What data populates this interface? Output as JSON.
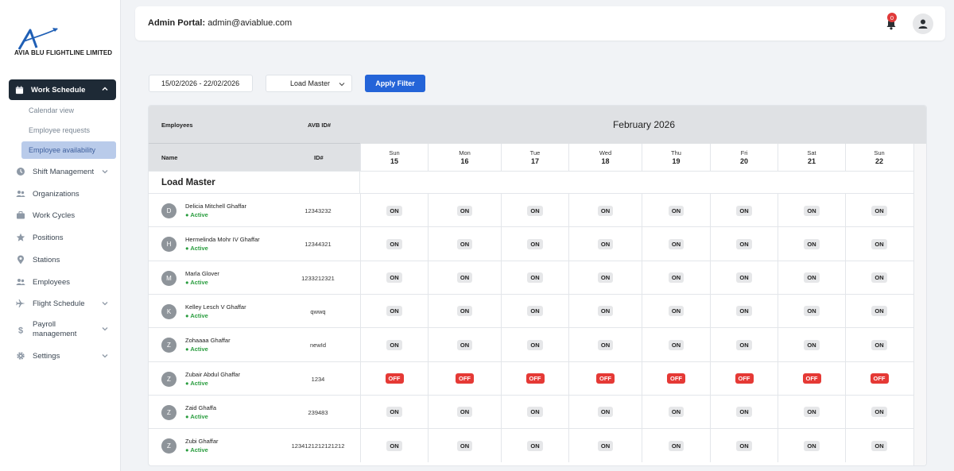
{
  "brand": {
    "name": "AVIA BLU FLIGHTLINE LIMITED"
  },
  "sidebar": {
    "active": {
      "label": "Work Schedule",
      "icon": "calendar-icon"
    },
    "subitems": [
      {
        "label": "Calendar view",
        "selected": false
      },
      {
        "label": "Employee requests",
        "selected": false
      },
      {
        "label": "Employee availability",
        "selected": true
      }
    ],
    "items": [
      {
        "label": "Shift Management",
        "icon": "clock-icon",
        "has_chevron": true
      },
      {
        "label": "Organizations",
        "icon": "users-icon",
        "has_chevron": false
      },
      {
        "label": "Work Cycles",
        "icon": "briefcase-icon",
        "has_chevron": false
      },
      {
        "label": "Positions",
        "icon": "star-icon",
        "has_chevron": false
      },
      {
        "label": "Stations",
        "icon": "map-pin-icon",
        "has_chevron": false
      },
      {
        "label": "Employees",
        "icon": "users-icon",
        "has_chevron": false
      },
      {
        "label": "Flight Schedule",
        "icon": "plane-icon",
        "has_chevron": true
      },
      {
        "label": "Payroll management",
        "icon": "dollar-icon",
        "has_chevron": true
      },
      {
        "label": "Settings",
        "icon": "gear-icon",
        "has_chevron": true
      }
    ]
  },
  "header": {
    "portal_label": "Admin Portal:",
    "email": "admin@aviablue.com",
    "notification_count": "0"
  },
  "filters": {
    "date_range": "15/02/2026 - 22/02/2026",
    "position": "Load Master",
    "apply_label": "Apply Filter"
  },
  "table": {
    "headers": {
      "employees": "Employees",
      "avb_id": "AVB ID#",
      "name": "Name",
      "id": "ID#"
    },
    "month": "February 2026",
    "days": [
      {
        "name": "Sun",
        "date": "15"
      },
      {
        "name": "Mon",
        "date": "16"
      },
      {
        "name": "Tue",
        "date": "17"
      },
      {
        "name": "Wed",
        "date": "18"
      },
      {
        "name": "Thu",
        "date": "19"
      },
      {
        "name": "Fri",
        "date": "20"
      },
      {
        "name": "Sat",
        "date": "21"
      },
      {
        "name": "Sun",
        "date": "22"
      }
    ],
    "group": "Load Master",
    "rows": [
      {
        "initial": "D",
        "name": "Delicia Mitchell Ghaffar",
        "status": "● Active",
        "id": "12343232",
        "days": [
          "ON",
          "ON",
          "ON",
          "ON",
          "ON",
          "ON",
          "ON",
          "ON"
        ]
      },
      {
        "initial": "H",
        "name": "Hermelinda Mohr IV Ghaffar",
        "status": "● Active",
        "id": "12344321",
        "days": [
          "ON",
          "ON",
          "ON",
          "ON",
          "ON",
          "ON",
          "ON",
          "ON"
        ]
      },
      {
        "initial": "M",
        "name": "Marla Glover",
        "status": "● Active",
        "id": "1233212321",
        "days": [
          "ON",
          "ON",
          "ON",
          "ON",
          "ON",
          "ON",
          "ON",
          "ON"
        ]
      },
      {
        "initial": "K",
        "name": "Kelley Lesch V Ghaffar",
        "status": "● Active",
        "id": "qwwq",
        "days": [
          "ON",
          "ON",
          "ON",
          "ON",
          "ON",
          "ON",
          "ON",
          "ON"
        ]
      },
      {
        "initial": "Z",
        "name": "Zohaaaa Ghaffar",
        "status": "● Active",
        "id": "newId",
        "days": [
          "ON",
          "ON",
          "ON",
          "ON",
          "ON",
          "ON",
          "ON",
          "ON"
        ]
      },
      {
        "initial": "Z",
        "name": "Zubair Abdul Ghaffar",
        "status": "● Active",
        "id": "1234",
        "days": [
          "OFF",
          "OFF",
          "OFF",
          "OFF",
          "OFF",
          "OFF",
          "OFF",
          "OFF"
        ]
      },
      {
        "initial": "Z",
        "name": "Zaid Ghaffa",
        "status": "● Active",
        "id": "239483",
        "days": [
          "ON",
          "ON",
          "ON",
          "ON",
          "ON",
          "ON",
          "ON",
          "ON"
        ]
      },
      {
        "initial": "Z",
        "name": "Zubi Ghaffar",
        "status": "● Active",
        "id": "1234121212121212",
        "days": [
          "ON",
          "ON",
          "ON",
          "ON",
          "ON",
          "ON",
          "ON",
          "ON"
        ]
      }
    ]
  },
  "colors": {
    "primary": "#2464d8",
    "nav_active": "#1e2a36",
    "off": "#e53935",
    "active_status": "#2a9d3f"
  }
}
